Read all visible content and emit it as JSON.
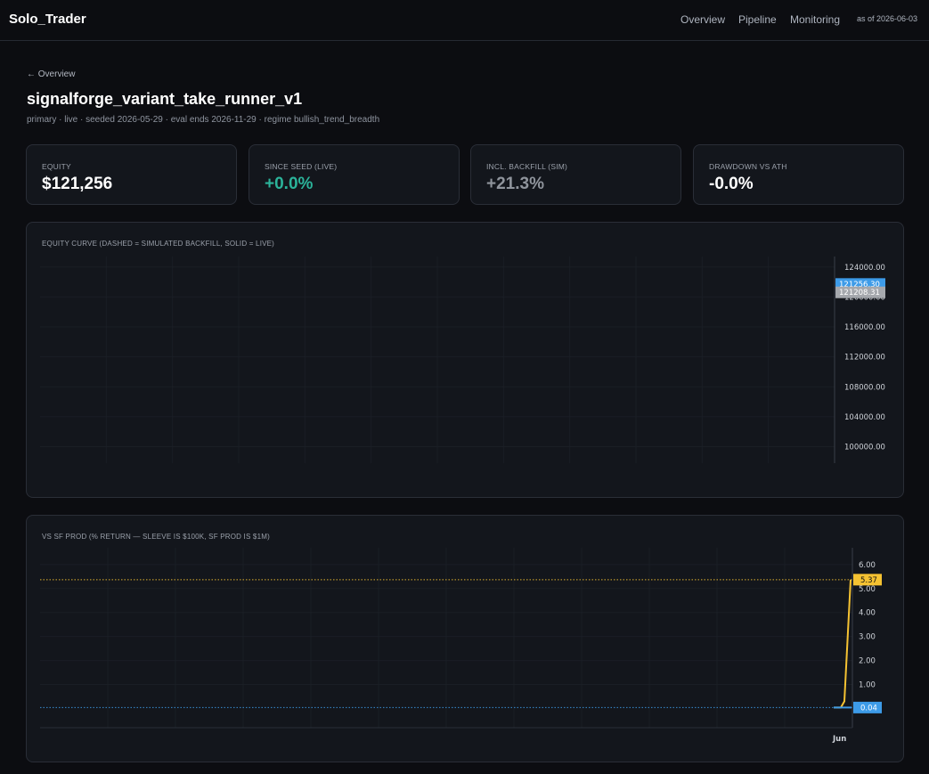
{
  "header": {
    "brand": "Solo_Trader",
    "nav": [
      "Overview",
      "Pipeline",
      "Monitoring"
    ],
    "as_of": "as of 2026-06-03"
  },
  "page": {
    "back_link": "← Overview",
    "title": "signalforge_variant_take_runner_v1",
    "subtitle": "primary · live · seeded 2026-05-29 · eval ends 2026-11-29 · regime bullish_trend_breadth"
  },
  "cards": [
    {
      "label": "EQUITY",
      "value": "$121,256"
    },
    {
      "label": "SINCE SEED (LIVE)",
      "value": "+0.0%"
    },
    {
      "label": "INCL. BACKFILL (SIM)",
      "value": "+21.3%"
    },
    {
      "label": "DRAWDOWN VS ATH",
      "value": "-0.0%"
    }
  ],
  "colors": {
    "accent_blue": "#3d9be8",
    "accent_yellow": "#f5c232",
    "positive_green": "#2bb39a",
    "sim_gray": "#a5a8ad"
  },
  "chart_data": [
    {
      "type": "line",
      "title": "EQUITY CURVE (DASHED = SIMULATED BACKFILL, SOLID = LIVE)",
      "ylim": [
        97800,
        125400
      ],
      "y_ticks": [
        "124000.00",
        "120000.00",
        "116000.00",
        "112000.00",
        "108000.00",
        "104000.00",
        "100000.00"
      ],
      "grid": true,
      "price_tags": [
        {
          "value": 121256.3,
          "label": "121256.30",
          "color": "#3d9be8"
        },
        {
          "value": 121208.31,
          "label": "121208.31",
          "color": "#a5a8ad"
        }
      ]
    },
    {
      "type": "line",
      "title": "VS SF PROD (% RETURN — SLEEVE IS $100K, SF PROD IS $1M)",
      "ylim": [
        -0.8,
        6.7
      ],
      "y_ticks": [
        "6.00",
        "5.00",
        "4.00",
        "3.00",
        "2.00",
        "1.00"
      ],
      "x_ticks": [
        "Jun"
      ],
      "grid": true,
      "series": [
        {
          "values": [
            0.04,
            0.04,
            0.3,
            5.37
          ],
          "color": "#f5c232"
        },
        {
          "values": [
            0.04,
            0.04
          ],
          "color": "#3d9be8"
        }
      ],
      "price_tags": [
        {
          "value": 5.37,
          "label": "5.37",
          "color": "#f5c232"
        },
        {
          "value": 0.04,
          "label": "0.04",
          "color": "#3d9be8"
        }
      ]
    }
  ]
}
